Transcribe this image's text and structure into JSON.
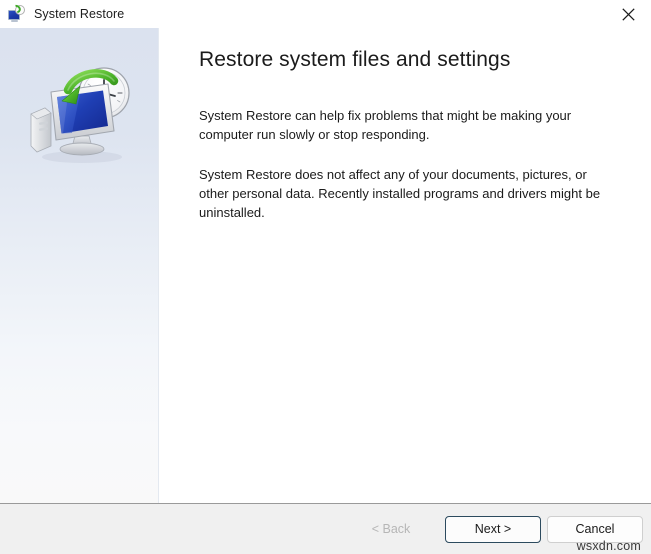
{
  "window": {
    "title": "System Restore",
    "app_icon": "system-restore-icon",
    "close_icon": "close-icon"
  },
  "sidebar": {
    "illustration": "system-restore-computer-clock-illustration",
    "gradient_top": "#dbe2ef",
    "gradient_bottom": "#f9f9f9"
  },
  "main": {
    "heading": "Restore system files and settings",
    "paragraphs": [
      "System Restore can help fix problems that might be making your computer run slowly or stop responding.",
      "System Restore does not affect any of your documents, pictures, or other personal data. Recently installed programs and drivers might be uninstalled."
    ]
  },
  "footer": {
    "buttons": [
      {
        "label": "< Back",
        "state": "disabled"
      },
      {
        "label": "Next >",
        "state": "default"
      },
      {
        "label": "Cancel",
        "state": "normal"
      }
    ],
    "watermark": "wsxdn.com"
  },
  "colors": {
    "text": "#1b1b1b",
    "disabled_text": "#b6b6b6",
    "footer_bg": "#f0f0f0",
    "default_button_border": "#2c4a5e"
  }
}
